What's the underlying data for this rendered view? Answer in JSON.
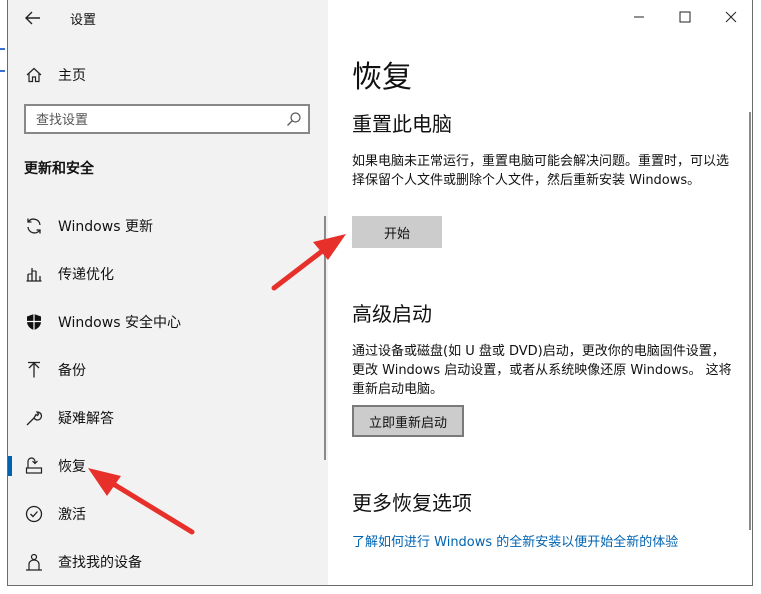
{
  "window": {
    "title": "设置"
  },
  "sidebar": {
    "home_label": "主页",
    "search_placeholder": "查找设置",
    "section_title": "更新和安全",
    "items": [
      {
        "label": "Windows 更新",
        "icon": "refresh-icon"
      },
      {
        "label": "传递优化",
        "icon": "delivery-optimization-icon"
      },
      {
        "label": "Windows 安全中心",
        "icon": "shield-icon"
      },
      {
        "label": "备份",
        "icon": "backup-arrow-icon"
      },
      {
        "label": "疑难解答",
        "icon": "wrench-icon"
      },
      {
        "label": "恢复",
        "icon": "recovery-icon",
        "selected": true
      },
      {
        "label": "激活",
        "icon": "checkmark-circle-icon"
      },
      {
        "label": "查找我的设备",
        "icon": "person-location-icon"
      }
    ]
  },
  "main": {
    "page_title": "恢复",
    "reset": {
      "heading": "重置此电脑",
      "description": "如果电脑未正常运行，重置电脑可能会解决问题。重置时，可以选择保留个人文件或删除个人文件，然后重新安装 Windows。",
      "button_label": "开始"
    },
    "advanced": {
      "heading": "高级启动",
      "description": "通过设备或磁盘(如 U 盘或 DVD)启动，更改你的电脑固件设置，更改 Windows 启动设置，或者从系统映像还原 Windows。 这将重新启动电脑。",
      "button_label": "立即重新启动"
    },
    "more": {
      "heading": "更多恢复选项",
      "link_text": "了解如何进行 Windows 的全新安装以便开始全新的体验"
    }
  },
  "colors": {
    "accent": "#0063b1",
    "sidebar_bg": "#f2f2f2",
    "annotation_arrow": "#e8302a"
  }
}
